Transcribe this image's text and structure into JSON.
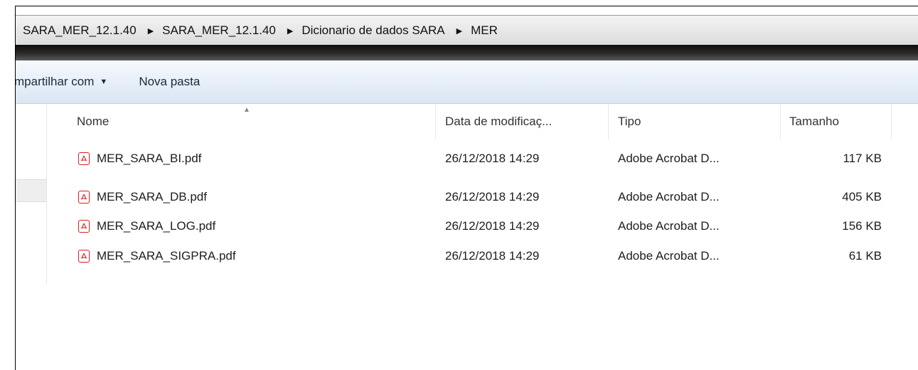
{
  "breadcrumb": {
    "items": [
      {
        "label": "SARA_MER_12.1.40"
      },
      {
        "label": "SARA_MER_12.1.40"
      },
      {
        "label": "Dicionario de dados SARA"
      },
      {
        "label": "MER"
      }
    ],
    "separator": "▶"
  },
  "toolbar": {
    "share_label": "mpartilhar com",
    "share_caret": "▼",
    "new_folder_label": "Nova pasta"
  },
  "columns": {
    "name": "Nome",
    "date": "Data de modificaç...",
    "type": "Tipo",
    "size": "Tamanho",
    "sort_arrow": "▲"
  },
  "files": [
    {
      "name": "MER_SARA_BI.pdf",
      "date": "26/12/2018 14:29",
      "type": "Adobe Acrobat D...",
      "size": "117 KB",
      "icon": "pdf-icon"
    },
    {
      "name": "MER_SARA_DB.pdf",
      "date": "26/12/2018 14:29",
      "type": "Adobe Acrobat D...",
      "size": "405 KB",
      "icon": "pdf-icon"
    },
    {
      "name": "MER_SARA_LOG.pdf",
      "date": "26/12/2018 14:29",
      "type": "Adobe Acrobat D...",
      "size": "156 KB",
      "icon": "pdf-icon"
    },
    {
      "name": "MER_SARA_SIGPRA.pdf",
      "date": "26/12/2018 14:29",
      "type": "Adobe Acrobat D...",
      "size": "61 KB",
      "icon": "pdf-icon"
    }
  ],
  "colors": {
    "pdf_red": "#d42020",
    "toolbar_blue": "#e6eef8",
    "address_gray": "#dcdcdc"
  }
}
